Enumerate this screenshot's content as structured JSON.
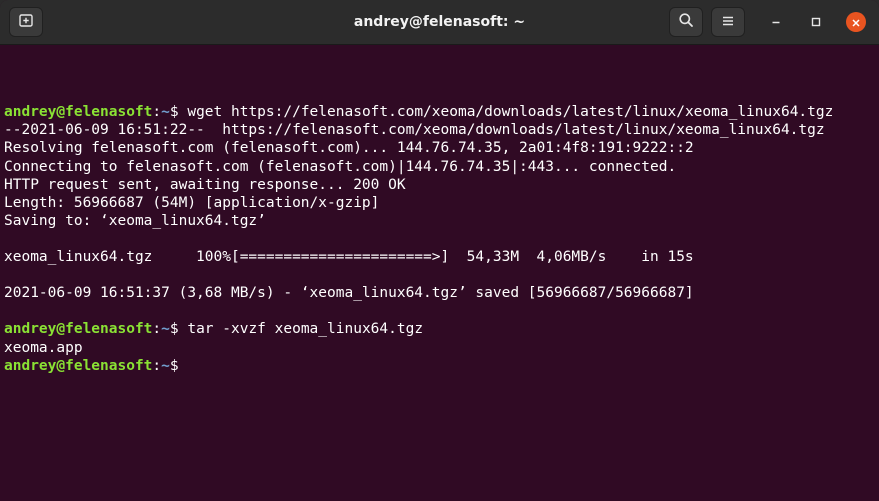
{
  "window": {
    "title": "andrey@felenasoft: ~"
  },
  "titlebar": {
    "new_tab_icon": "new-tab-icon",
    "search_icon": "search-icon",
    "menu_icon": "hamburger-menu-icon",
    "minimize_icon": "minimize-icon",
    "maximize_icon": "maximize-icon",
    "close_icon": "close-icon"
  },
  "colors": {
    "terminal_bg": "#300a24",
    "prompt_user": "#8ae234",
    "prompt_path": "#729fcf",
    "close_button": "#e95420"
  },
  "terminal": {
    "lines": [
      {
        "type": "prompt",
        "user": "andrey@felenasoft",
        "sep": ":",
        "path": "~",
        "sym": "$ ",
        "cmd": "wget https://felenasoft.com/xeoma/downloads/latest/linux/xeoma_linux64.tgz"
      },
      {
        "type": "out",
        "text": "--2021-06-09 16:51:22--  https://felenasoft.com/xeoma/downloads/latest/linux/xeoma_linux64.tgz"
      },
      {
        "type": "out",
        "text": "Resolving felenasoft.com (felenasoft.com)... 144.76.74.35, 2a01:4f8:191:9222::2"
      },
      {
        "type": "out",
        "text": "Connecting to felenasoft.com (felenasoft.com)|144.76.74.35|:443... connected."
      },
      {
        "type": "out",
        "text": "HTTP request sent, awaiting response... 200 OK"
      },
      {
        "type": "out",
        "text": "Length: 56966687 (54M) [application/x-gzip]"
      },
      {
        "type": "out",
        "text": "Saving to: ‘xeoma_linux64.tgz’"
      },
      {
        "type": "out",
        "text": ""
      },
      {
        "type": "out",
        "text": "xeoma_linux64.tgz     100%[======================>]  54,33M  4,06MB/s    in 15s"
      },
      {
        "type": "out",
        "text": ""
      },
      {
        "type": "out",
        "text": "2021-06-09 16:51:37 (3,68 MB/s) - ‘xeoma_linux64.tgz’ saved [56966687/56966687]"
      },
      {
        "type": "out",
        "text": ""
      },
      {
        "type": "prompt",
        "user": "andrey@felenasoft",
        "sep": ":",
        "path": "~",
        "sym": "$ ",
        "cmd": "tar -xvzf xeoma_linux64.tgz"
      },
      {
        "type": "out",
        "text": "xeoma.app"
      },
      {
        "type": "prompt",
        "user": "andrey@felenasoft",
        "sep": ":",
        "path": "~",
        "sym": "$",
        "cmd": ""
      }
    ]
  }
}
